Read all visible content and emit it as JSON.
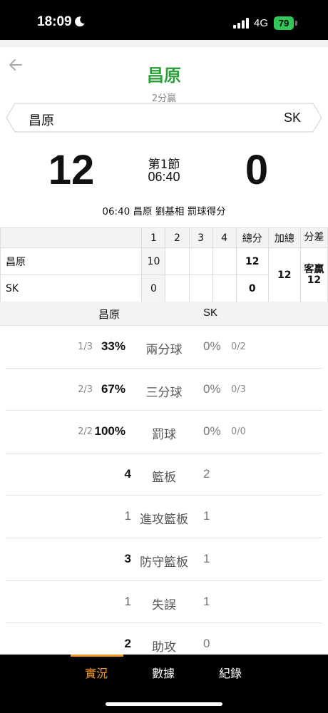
{
  "status_bar": {
    "time": "18:09",
    "network": "4G",
    "battery": "79"
  },
  "header": {
    "title": "昌原",
    "subtitle": "2分贏",
    "home_team": "昌原",
    "away_team": "SK"
  },
  "score": {
    "home": "12",
    "away": "0",
    "period": "第1節",
    "clock": "06:40",
    "last_play": "06:40 昌原 劉基相 罰球得分"
  },
  "box_score": {
    "headers": [
      "",
      "1",
      "2",
      "3",
      "4",
      "總分",
      "加總",
      "分差"
    ],
    "rows": [
      {
        "team": "昌原",
        "q1": "10",
        "q2": "",
        "q3": "",
        "q4": "",
        "total": "12"
      },
      {
        "team": "SK",
        "q1": "0",
        "q2": "",
        "q3": "",
        "q4": "",
        "total": "0"
      }
    ],
    "sum": "12",
    "diff_label": "客贏",
    "diff_value": "12"
  },
  "comparison": {
    "home": "昌原",
    "away": "SK",
    "rows": [
      {
        "label": "兩分球",
        "home_frac": "1/3",
        "home": "33%",
        "away": "0%",
        "away_frac": "0/2"
      },
      {
        "label": "三分球",
        "home_frac": "2/3",
        "home": "67%",
        "away": "0%",
        "away_frac": "0/3"
      },
      {
        "label": "罰球",
        "home_frac": "2/2",
        "home": "100%",
        "away": "0%",
        "away_frac": "0/0"
      },
      {
        "label": "籃板",
        "home_frac": "",
        "home": "4",
        "away": "2",
        "away_frac": ""
      },
      {
        "label": "進攻籃板",
        "home_frac": "",
        "home": "1",
        "away": "1",
        "away_frac": ""
      },
      {
        "label": "防守籃板",
        "home_frac": "",
        "home": "3",
        "away": "1",
        "away_frac": ""
      },
      {
        "label": "失誤",
        "home_frac": "",
        "home": "1",
        "away": "1",
        "away_frac": ""
      },
      {
        "label": "助攻",
        "home_frac": "",
        "home": "2",
        "away": "0",
        "away_frac": ""
      }
    ]
  },
  "tabs": [
    {
      "label": "實況",
      "active": true
    },
    {
      "label": "數據",
      "active": false
    },
    {
      "label": "紀錄",
      "active": false
    }
  ],
  "colors": {
    "team_title": "#2e9e3c",
    "tab_active": "#f39a1e",
    "battery": "#31c759"
  }
}
